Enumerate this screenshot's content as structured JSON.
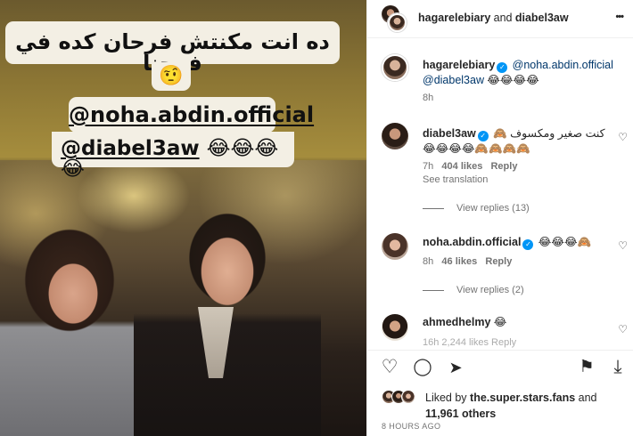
{
  "story": {
    "line1": "ده انت مكنتش فرحان كده في فرحنا",
    "line2": "🤨",
    "mention1": "@noha.abdin.official",
    "mention2": "@diabel3aw",
    "mention2_emojis": "😂😂😂😂"
  },
  "header": {
    "user1": "hagarelebiary",
    "and": "and",
    "user2": "diabel3aw",
    "more": "•••"
  },
  "caption": {
    "user": "hagarelebiary",
    "mention1": "@noha.abdin.official",
    "mention2": "@diabel3aw",
    "emojis": "😂😂😂😂",
    "time": "8h"
  },
  "comments": [
    {
      "user": "diabel3aw",
      "text": "كنت صغير ومكسوف 🙈🙈🙈🙈🙈😂😂😂😂",
      "time": "7h",
      "likes": "404",
      "likes_label": "likes",
      "reply": "Reply",
      "translate": "See translation",
      "view_replies": "View replies (13)"
    },
    {
      "user": "noha.abdin.official",
      "text": "😂😂😂🙈",
      "time": "8h",
      "likes": "46",
      "likes_label": "likes",
      "reply": "Reply",
      "view_replies": "View replies (2)"
    },
    {
      "user": "ahmedhelmy",
      "text": "😂",
      "partial": "16h  2,244 likes  Reply"
    }
  ],
  "actions": {
    "like": "♡",
    "comment": "◯",
    "share": "➤",
    "save": "⚑",
    "download": "⤓"
  },
  "liked_by": {
    "prefix": "Liked by",
    "user": "the.super.stars.fans",
    "and": "and",
    "count": "11,961",
    "others": "others"
  },
  "timestamp": "8 HOURS AGO",
  "colors": {
    "verified": "#0095f6",
    "story_bubble": "#f3efe4",
    "link": "#00376b"
  }
}
